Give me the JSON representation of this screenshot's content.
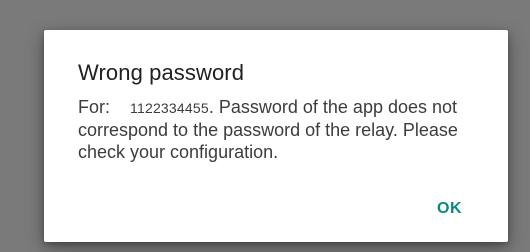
{
  "dialog": {
    "title": "Wrong password",
    "message_prefix": "For:",
    "relay_id": "1122334455",
    "message_rest": ". Password of the app does not correspond to the password of the relay. Please check your configuration.",
    "ok_label": "OK"
  },
  "colors": {
    "scrim": "#7a7a7a",
    "dialog_background": "#ffffff",
    "title_text": "#212121",
    "body_text": "#3c3c3c",
    "accent": "#0a8a7e"
  }
}
